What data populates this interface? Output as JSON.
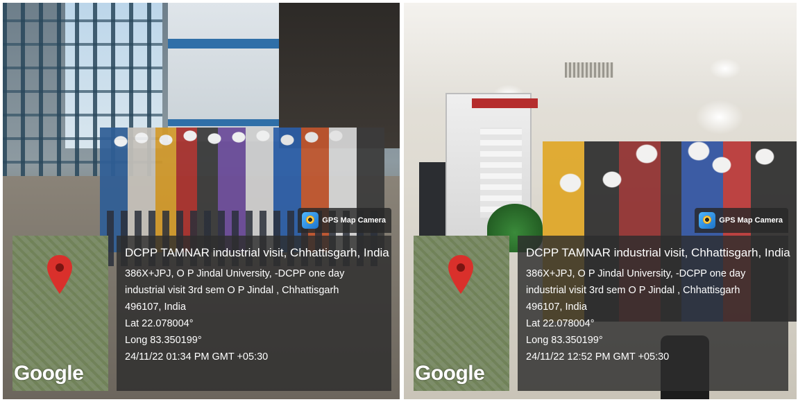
{
  "photos": [
    {
      "badge": "GPS Map Camera",
      "map_brand": "Google",
      "title": "DCPP TAMNAR industrial visit, Chhattisgarh, India",
      "address_lines": [
        "386X+JPJ, O P Jindal University, -DCPP one day",
        "industrial visit 3rd sem O P Jindal , Chhattisgarh",
        "496107, India"
      ],
      "lat": "Lat 22.078004°",
      "long": "Long 83.350199°",
      "timestamp": "24/11/22 01:34 PM GMT +05:30",
      "pin_color": "#d9302b"
    },
    {
      "badge": "GPS Map Camera",
      "map_brand": "Google",
      "title": "DCPP TAMNAR industrial visit, Chhattisgarh, India",
      "address_lines": [
        "386X+JPJ, O P Jindal University, -DCPP one day",
        "industrial visit 3rd sem O P Jindal , Chhattisgarh",
        "496107, India"
      ],
      "lat": "Lat 22.078004°",
      "long": "Long 83.350199°",
      "timestamp": "24/11/22 12:52 PM GMT +05:30",
      "pin_color": "#d9302b"
    }
  ]
}
